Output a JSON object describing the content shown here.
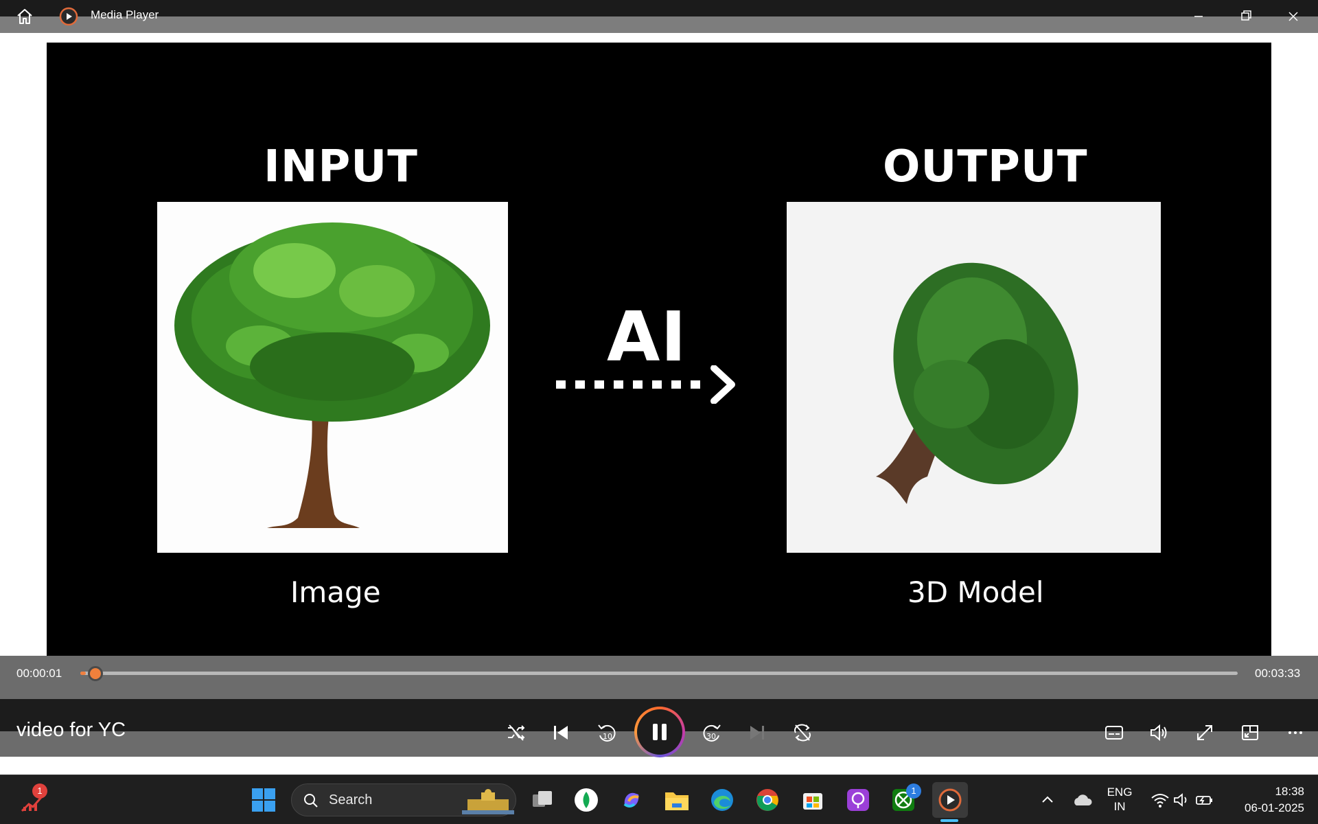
{
  "window": {
    "title": "Media Player"
  },
  "video": {
    "left_heading": "INPUT",
    "right_heading": "OUTPUT",
    "center_label": "AI",
    "left_caption": "Image",
    "right_caption": "3D Model"
  },
  "controls": {
    "current_time": "00:00:01",
    "total_time": "00:03:33",
    "progress_fraction": 0.005,
    "video_title": "video for YC"
  },
  "taskbar": {
    "search_placeholder": "Search",
    "widget_badge": "1",
    "xbox_badge": "1",
    "language_line1": "ENG",
    "language_line2": "IN",
    "clock_time": "18:38",
    "clock_date": "06-01-2025"
  },
  "colors": {
    "accent": "#f0803c",
    "badge": "#e0413c",
    "xbox_badge": "#2d7de0"
  }
}
